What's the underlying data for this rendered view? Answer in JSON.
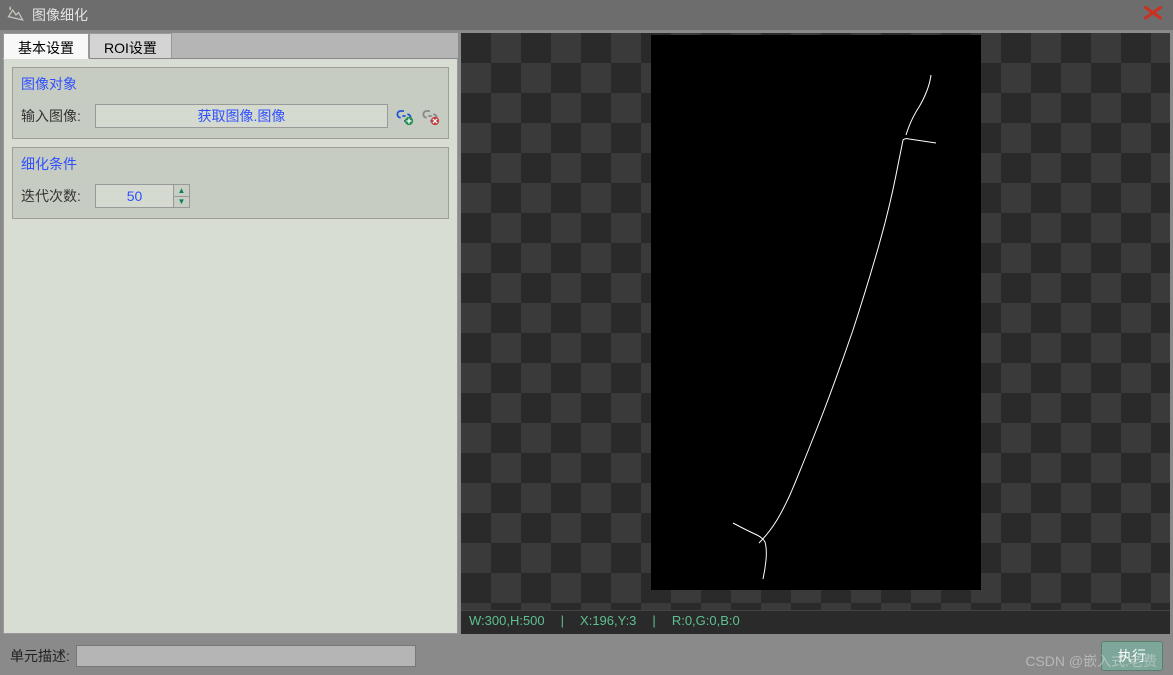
{
  "window": {
    "title": "图像细化"
  },
  "tabs": {
    "basic": "基本设置",
    "roi": "ROI设置"
  },
  "group_image": {
    "title": "图像对象",
    "input_label": "输入图像:",
    "input_value": "获取图像.图像"
  },
  "group_condition": {
    "title": "细化条件",
    "iter_label": "迭代次数:",
    "iter_value": "50"
  },
  "status": {
    "wh": "W:300,H:500",
    "xy": "X:196,Y:3",
    "rgb": "R:0,G:0,B:0"
  },
  "footer": {
    "desc_label": "单元描述:",
    "exec": "执行"
  },
  "watermark": "CSDN @嵌入式.老费"
}
